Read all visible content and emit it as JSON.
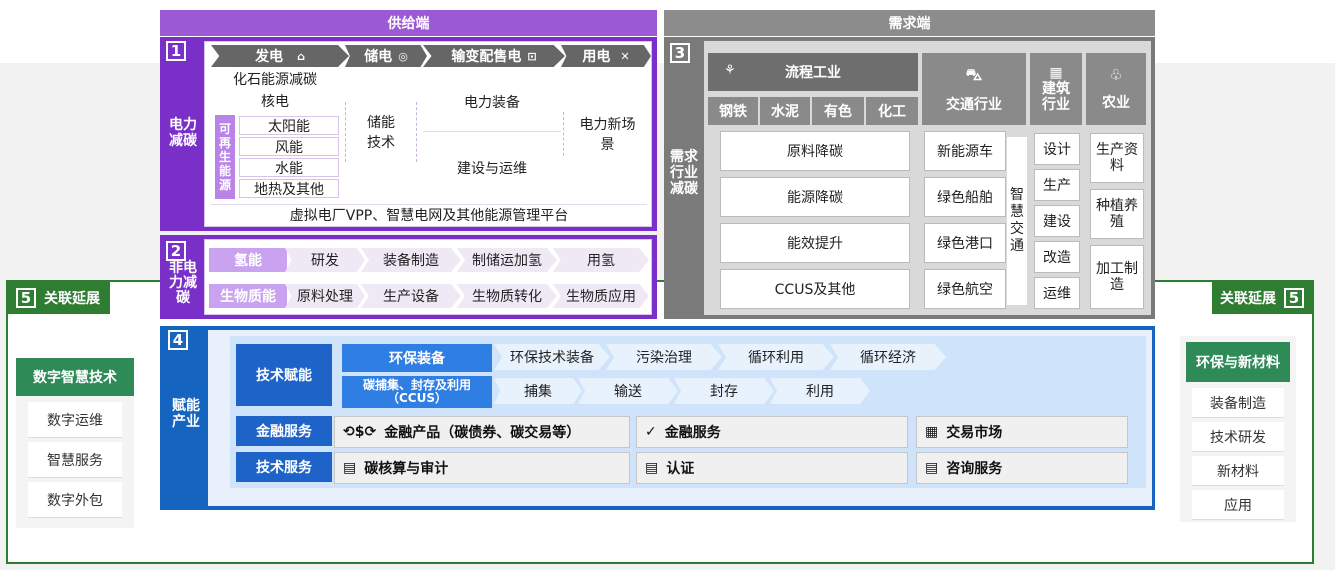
{
  "supply": {
    "header": "供给端",
    "num1": "1",
    "label1": "电力\n减碳",
    "chev": [
      "发电",
      "储电",
      "输变配售电",
      "用电"
    ],
    "gen_rows": [
      "化石能源减碳",
      "核电"
    ],
    "renew_label": "可\n再\n生\n能\n源",
    "renew_items": [
      "太阳能",
      "风能",
      "水能",
      "地热及其他"
    ],
    "storage": "储能\n技术",
    "grid": [
      "电力装备",
      "建设与运维"
    ],
    "use": "电力新场\n景",
    "platform": "虚拟电厂VPP、智慧电网及其他能源管理平台",
    "num2": "2",
    "label2": "非电\n力减\n碳",
    "hydrogen": {
      "tag": "氢能",
      "steps": [
        "研发",
        "装备制造",
        "制储运加氢",
        "用氢"
      ]
    },
    "biomass": {
      "tag": "生物质能",
      "steps": [
        "原料处理",
        "生产设备",
        "生物质转化",
        "生物质应用"
      ]
    }
  },
  "demand": {
    "header": "需求端",
    "num3": "3",
    "label3": "需求\n行业\n减碳",
    "process": "流程工业",
    "process_sub": [
      "钢铁",
      "水泥",
      "有色",
      "化工"
    ],
    "process_items": [
      "原料降碳",
      "能源降碳",
      "能效提升",
      "CCUS及其他"
    ],
    "transport": "交通行业",
    "transport_items": [
      "新能源车",
      "绿色船舶",
      "绿色港口",
      "绿色航空"
    ],
    "smart_traffic": "智\n慧\n交\n通",
    "building": "建筑\n行业",
    "building_items": [
      "设计",
      "生产",
      "建设",
      "改造",
      "运维"
    ],
    "agri": "农业",
    "agri_items": [
      "生产资\n料",
      "种植养\n殖",
      "加工制\n造"
    ]
  },
  "enable": {
    "num4": "4",
    "label4": "赋能\n产业",
    "tech_empower": "技术赋能",
    "env_tag": "环保装备",
    "env_steps": [
      "环保技术装备",
      "污染治理",
      "循环利用",
      "循环经济"
    ],
    "ccus_tag": "碳捕集、封存及利用\n（CCUS）",
    "ccus_steps": [
      "捕集",
      "输送",
      "封存",
      "利用"
    ],
    "finance_label": "金融服务",
    "finance_items": [
      "金融产品（碳债券、碳交易等）",
      "金融服务",
      "交易市场"
    ],
    "techservice_label": "技术服务",
    "techservice_items": [
      "碳核算与审计",
      "认证",
      "咨询服务"
    ]
  },
  "extend_left": {
    "num": "5",
    "title": "关联延展",
    "highlight": "数字智慧技术",
    "items": [
      "数字运维",
      "智慧服务",
      "数字外包"
    ]
  },
  "extend_right": {
    "num": "5",
    "title": "关联延展",
    "highlight": "环保与新材料",
    "items": [
      "装备制造",
      "技术研发",
      "新材料",
      "应用"
    ]
  },
  "colors": {
    "supply": "#7b2fc9",
    "demand": "#7a7a7a",
    "enable": "#1565c0",
    "extend": "#2e7d32"
  }
}
